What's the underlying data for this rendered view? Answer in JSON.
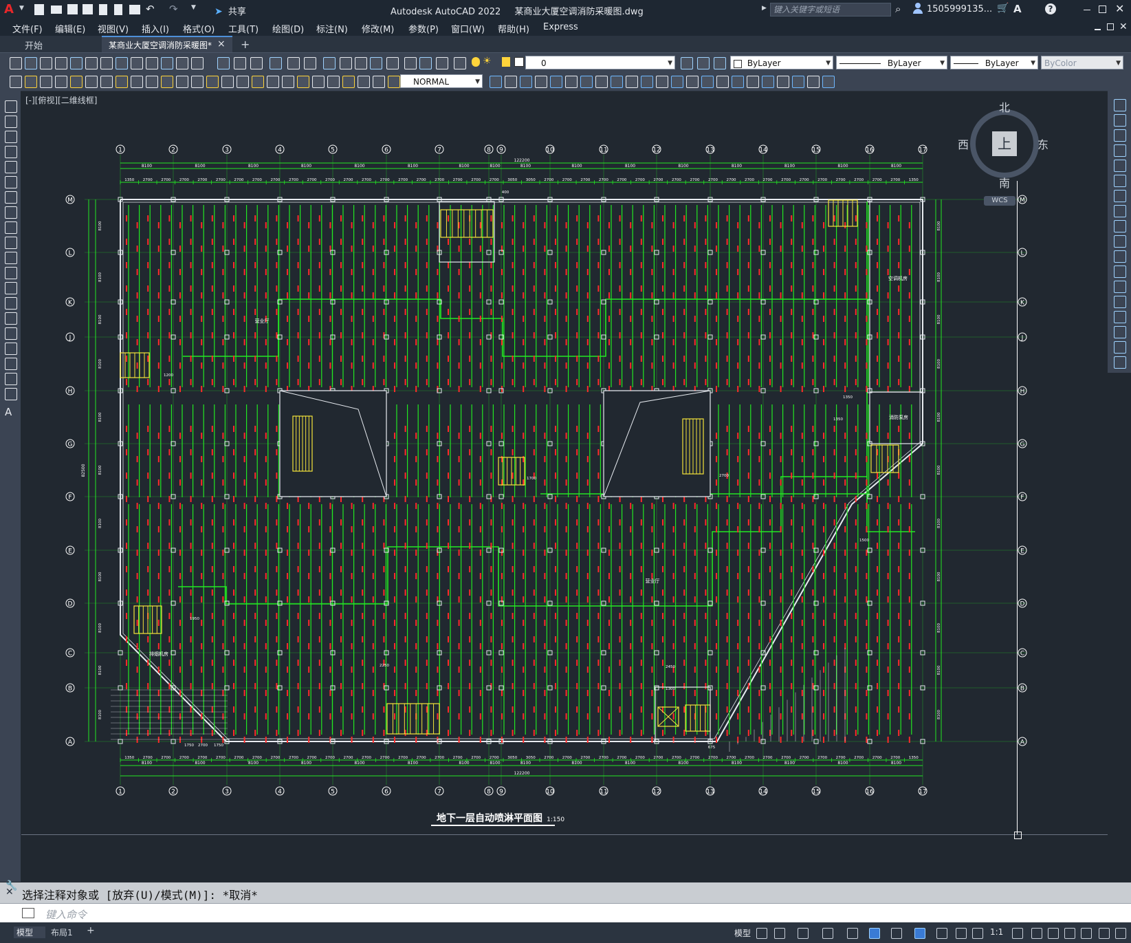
{
  "app": {
    "title": "Autodesk AutoCAD 2022",
    "file": "某商业大厦空调消防采暖图.dwg",
    "share_label": "共享",
    "search_placeholder": "键入关键字或短语",
    "user": "1505999135...",
    "accent": "#e8272a"
  },
  "menu": [
    "文件(F)",
    "编辑(E)",
    "视图(V)",
    "插入(I)",
    "格式(O)",
    "工具(T)",
    "绘图(D)",
    "标注(N)",
    "修改(M)",
    "参数(P)",
    "窗口(W)",
    "帮助(H)",
    "Express"
  ],
  "tabs": {
    "start": "开始",
    "active": "某商业大厦空调消防采暖图*",
    "close": "×",
    "add": "+"
  },
  "toolbar": {
    "layer_value": "0",
    "color_value": "ByLayer",
    "linetype_value": "ByLayer",
    "lineweight_value": "ByLayer",
    "plotstyle_value": "ByColor",
    "dimstyle_value": "NORMAL"
  },
  "viewport": {
    "label": "[-][俯视][二维线框]",
    "drawing_title": "地下一层自动喷淋平面图",
    "scale": "1:150",
    "total_dim": "122200",
    "span_dim": "8100",
    "sub_dims": [
      "1350",
      "2700",
      "2700",
      "2700",
      "2700",
      "2700",
      "2700",
      "2700",
      "2700",
      "2700",
      "2700",
      "2700",
      "2700",
      "2700",
      "2700",
      "2700",
      "2700",
      "2700",
      "2700",
      "2700",
      "2700",
      "3050",
      "3050",
      "2700",
      "2700",
      "2700",
      "2700",
      "2700",
      "2700",
      "2700",
      "2700",
      "2700",
      "2700",
      "2700",
      "2700",
      "2700",
      "2700",
      "2700",
      "2700",
      "2700",
      "2700",
      "2700",
      "2700",
      "1350"
    ],
    "col_labels": [
      "1",
      "2",
      "3",
      "4",
      "5",
      "6",
      "7",
      "8",
      "9",
      "10",
      "11",
      "12",
      "13",
      "14",
      "15",
      "16",
      "17"
    ],
    "row_labels": [
      "M",
      "L",
      "K",
      "J",
      "H",
      "G",
      "F",
      "E",
      "D",
      "C",
      "B",
      "A"
    ],
    "vert_total": "82500",
    "room_labels": [
      "营业厅",
      "空调机房",
      "消防泵房",
      "营业厅",
      "排烟机房"
    ],
    "misc_dims": [
      "1200",
      "1700",
      "2700",
      "1950",
      "1750",
      "2700",
      "1750",
      "1350",
      "2450",
      "2250",
      "1500",
      "1300",
      "1350",
      "675",
      "400"
    ]
  },
  "viewcube": {
    "north": "北",
    "south": "南",
    "east": "东",
    "west": "西",
    "top": "上",
    "wcs": "WCS"
  },
  "command": {
    "history": "选择注释对象或 [放弃(U)/模式(M)]: *取消*",
    "placeholder": "键入命令"
  },
  "status": {
    "tab_model": "模型",
    "tab_layout": "布局1",
    "model_label": "模型",
    "scale": "1:1"
  }
}
